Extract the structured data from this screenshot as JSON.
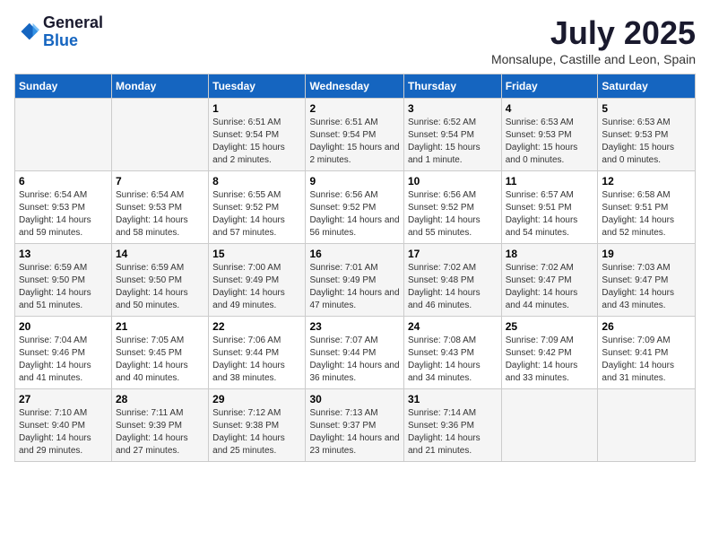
{
  "header": {
    "logo_line1": "General",
    "logo_line2": "Blue",
    "month": "July 2025",
    "location": "Monsalupe, Castille and Leon, Spain"
  },
  "weekdays": [
    "Sunday",
    "Monday",
    "Tuesday",
    "Wednesday",
    "Thursday",
    "Friday",
    "Saturday"
  ],
  "weeks": [
    [
      {
        "day": "",
        "info": ""
      },
      {
        "day": "",
        "info": ""
      },
      {
        "day": "1",
        "info": "Sunrise: 6:51 AM\nSunset: 9:54 PM\nDaylight: 15 hours and 2 minutes."
      },
      {
        "day": "2",
        "info": "Sunrise: 6:51 AM\nSunset: 9:54 PM\nDaylight: 15 hours and 2 minutes."
      },
      {
        "day": "3",
        "info": "Sunrise: 6:52 AM\nSunset: 9:54 PM\nDaylight: 15 hours and 1 minute."
      },
      {
        "day": "4",
        "info": "Sunrise: 6:53 AM\nSunset: 9:53 PM\nDaylight: 15 hours and 0 minutes."
      },
      {
        "day": "5",
        "info": "Sunrise: 6:53 AM\nSunset: 9:53 PM\nDaylight: 15 hours and 0 minutes."
      }
    ],
    [
      {
        "day": "6",
        "info": "Sunrise: 6:54 AM\nSunset: 9:53 PM\nDaylight: 14 hours and 59 minutes."
      },
      {
        "day": "7",
        "info": "Sunrise: 6:54 AM\nSunset: 9:53 PM\nDaylight: 14 hours and 58 minutes."
      },
      {
        "day": "8",
        "info": "Sunrise: 6:55 AM\nSunset: 9:52 PM\nDaylight: 14 hours and 57 minutes."
      },
      {
        "day": "9",
        "info": "Sunrise: 6:56 AM\nSunset: 9:52 PM\nDaylight: 14 hours and 56 minutes."
      },
      {
        "day": "10",
        "info": "Sunrise: 6:56 AM\nSunset: 9:52 PM\nDaylight: 14 hours and 55 minutes."
      },
      {
        "day": "11",
        "info": "Sunrise: 6:57 AM\nSunset: 9:51 PM\nDaylight: 14 hours and 54 minutes."
      },
      {
        "day": "12",
        "info": "Sunrise: 6:58 AM\nSunset: 9:51 PM\nDaylight: 14 hours and 52 minutes."
      }
    ],
    [
      {
        "day": "13",
        "info": "Sunrise: 6:59 AM\nSunset: 9:50 PM\nDaylight: 14 hours and 51 minutes."
      },
      {
        "day": "14",
        "info": "Sunrise: 6:59 AM\nSunset: 9:50 PM\nDaylight: 14 hours and 50 minutes."
      },
      {
        "day": "15",
        "info": "Sunrise: 7:00 AM\nSunset: 9:49 PM\nDaylight: 14 hours and 49 minutes."
      },
      {
        "day": "16",
        "info": "Sunrise: 7:01 AM\nSunset: 9:49 PM\nDaylight: 14 hours and 47 minutes."
      },
      {
        "day": "17",
        "info": "Sunrise: 7:02 AM\nSunset: 9:48 PM\nDaylight: 14 hours and 46 minutes."
      },
      {
        "day": "18",
        "info": "Sunrise: 7:02 AM\nSunset: 9:47 PM\nDaylight: 14 hours and 44 minutes."
      },
      {
        "day": "19",
        "info": "Sunrise: 7:03 AM\nSunset: 9:47 PM\nDaylight: 14 hours and 43 minutes."
      }
    ],
    [
      {
        "day": "20",
        "info": "Sunrise: 7:04 AM\nSunset: 9:46 PM\nDaylight: 14 hours and 41 minutes."
      },
      {
        "day": "21",
        "info": "Sunrise: 7:05 AM\nSunset: 9:45 PM\nDaylight: 14 hours and 40 minutes."
      },
      {
        "day": "22",
        "info": "Sunrise: 7:06 AM\nSunset: 9:44 PM\nDaylight: 14 hours and 38 minutes."
      },
      {
        "day": "23",
        "info": "Sunrise: 7:07 AM\nSunset: 9:44 PM\nDaylight: 14 hours and 36 minutes."
      },
      {
        "day": "24",
        "info": "Sunrise: 7:08 AM\nSunset: 9:43 PM\nDaylight: 14 hours and 34 minutes."
      },
      {
        "day": "25",
        "info": "Sunrise: 7:09 AM\nSunset: 9:42 PM\nDaylight: 14 hours and 33 minutes."
      },
      {
        "day": "26",
        "info": "Sunrise: 7:09 AM\nSunset: 9:41 PM\nDaylight: 14 hours and 31 minutes."
      }
    ],
    [
      {
        "day": "27",
        "info": "Sunrise: 7:10 AM\nSunset: 9:40 PM\nDaylight: 14 hours and 29 minutes."
      },
      {
        "day": "28",
        "info": "Sunrise: 7:11 AM\nSunset: 9:39 PM\nDaylight: 14 hours and 27 minutes."
      },
      {
        "day": "29",
        "info": "Sunrise: 7:12 AM\nSunset: 9:38 PM\nDaylight: 14 hours and 25 minutes."
      },
      {
        "day": "30",
        "info": "Sunrise: 7:13 AM\nSunset: 9:37 PM\nDaylight: 14 hours and 23 minutes."
      },
      {
        "day": "31",
        "info": "Sunrise: 7:14 AM\nSunset: 9:36 PM\nDaylight: 14 hours and 21 minutes."
      },
      {
        "day": "",
        "info": ""
      },
      {
        "day": "",
        "info": ""
      }
    ]
  ]
}
